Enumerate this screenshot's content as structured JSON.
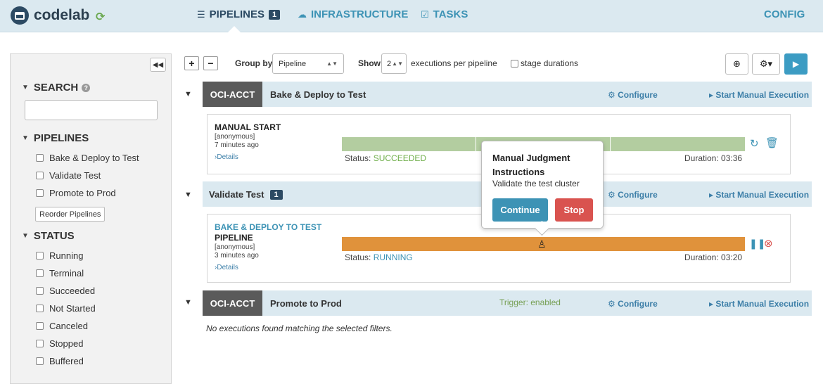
{
  "header": {
    "brand": "codelab",
    "nav": [
      {
        "label": "PIPELINES",
        "badge": "1"
      },
      {
        "label": "INFRASTRUCTURE"
      },
      {
        "label": "TASKS"
      }
    ],
    "config_label": "CONFIG"
  },
  "sidebar": {
    "search_title": "SEARCH",
    "search_value": "",
    "pipelines_title": "PIPELINES",
    "pipelines": [
      "Bake & Deploy to Test",
      "Validate Test",
      "Promote to Prod"
    ],
    "reorder_label": "Reorder Pipelines",
    "status_title": "STATUS",
    "statuses": [
      "Running",
      "Terminal",
      "Succeeded",
      "Not Started",
      "Canceled",
      "Stopped",
      "Buffered"
    ]
  },
  "toolbar": {
    "group_by_label": "Group by",
    "group_by_value": "Pipeline",
    "show_label": "Show",
    "show_value": "2",
    "executions_label": "executions per pipeline",
    "stage_durations_label": "stage durations"
  },
  "groups": [
    {
      "account": "OCI-ACCT",
      "title": "Bake & Deploy to Test",
      "configure": "Configure",
      "start": "Start Manual Execution"
    },
    {
      "title": "Validate Test",
      "badge": "1",
      "configure": "Configure",
      "start": "Start Manual Execution"
    },
    {
      "account": "OCI-ACCT",
      "title": "Promote to Prod",
      "trigger": "Trigger: enabled",
      "configure": "Configure",
      "start": "Start Manual Execution"
    }
  ],
  "executions": [
    {
      "title": "MANUAL START",
      "user": "[anonymous]",
      "time": "7 minutes ago",
      "details": "Details",
      "status_label": "Status:",
      "status": "SUCCEEDED",
      "duration": "Duration: 03:36"
    },
    {
      "title_link": "BAKE & DEPLOY TO TEST",
      "title": "PIPELINE",
      "user": "[anonymous]",
      "time": "3 minutes ago",
      "details": "Details",
      "status_label": "Status:",
      "status": "RUNNING",
      "duration": "Duration: 03:20"
    }
  ],
  "no_executions": "No executions found matching the selected filters.",
  "popover": {
    "title": "Manual Judgment Instructions",
    "text": "Validate the test cluster",
    "continue_label": "Continue",
    "stop_label": "Stop"
  },
  "colors": {
    "succeeded_bar": "#b3cda0",
    "running_bar": "#e0923b",
    "continue_btn": "#3d93b5",
    "stop_btn": "#d9534f"
  }
}
